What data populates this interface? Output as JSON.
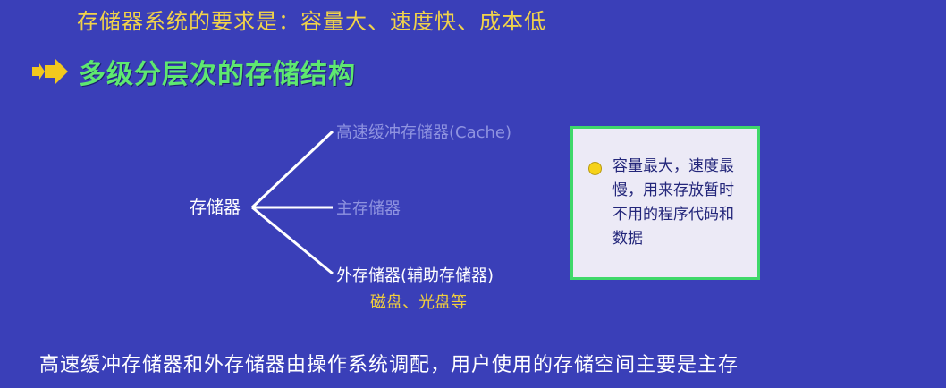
{
  "header": {
    "requirement_text": "存储器系统的要求是：容量大、速度快、成本低",
    "heading": "多级分层次的存储结构",
    "arrow_icon": "double-arrow-bullet-icon"
  },
  "tree": {
    "root": "存储器",
    "branches": [
      {
        "label": "高速缓冲存储器(Cache)"
      },
      {
        "label": "主存储器"
      },
      {
        "label": "外存储器(辅助存储器)",
        "sub": "磁盘、光盘等"
      }
    ]
  },
  "note": {
    "bullet_icon": "yellow-circle-bullet-icon",
    "text": "容量最大，速度最慢，用来存放暂时不用的程序代码和数据"
  },
  "footer": {
    "text": "高速缓冲存储器和外存储器由操作系统调配，用户使用的存储空间主要是主存"
  },
  "colors": {
    "background": "#3a3fb8",
    "requirement": "#f0d24a",
    "heading": "#5ee870",
    "note_border": "#3fd86a"
  }
}
